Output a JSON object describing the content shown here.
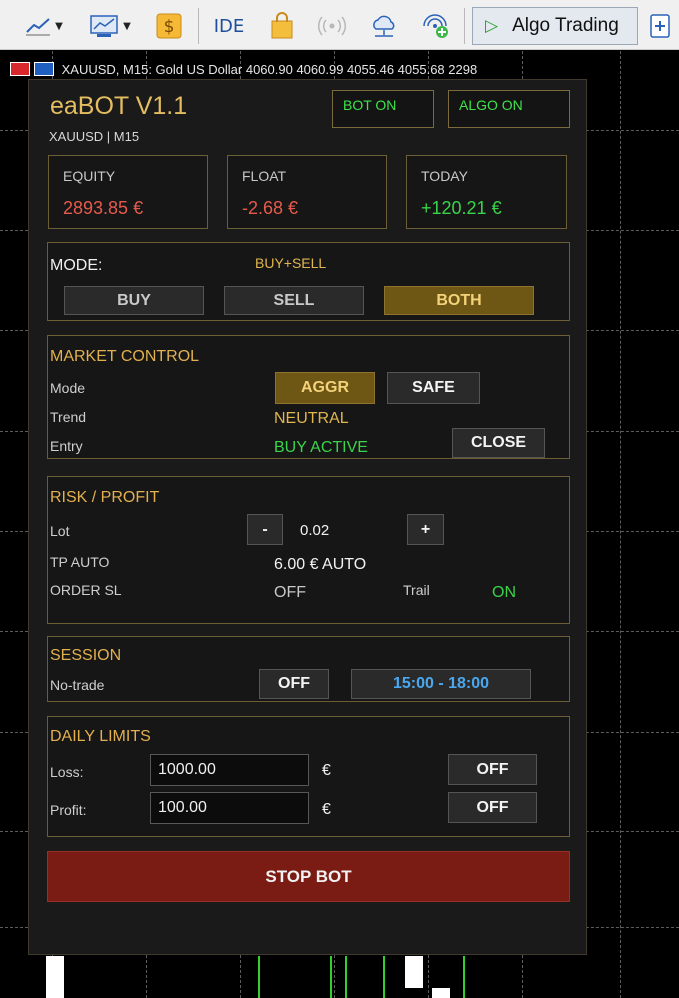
{
  "toolbar": {
    "ide_label": "IDE",
    "algo_label": "Algo Trading"
  },
  "chart": {
    "title": "XAUUSD, M15:  Gold US Dollar  4060.90 4060.99 4055.46 4055.68  2298"
  },
  "bot": {
    "title": "eaBOT V1.1",
    "subtitle": "XAUUSD | M15",
    "bot_on_label": "BOT ON",
    "algo_on_label": "ALGO ON",
    "cards": [
      {
        "label": "EQUITY",
        "value": "2893.85 €",
        "color": "#e65a4c"
      },
      {
        "label": "FLOAT",
        "value": "-2.68 €",
        "color": "#e65a4c"
      },
      {
        "label": "TODAY",
        "value": "+120.21 €",
        "color": "#39d44a"
      }
    ],
    "mode": {
      "label": "MODE:",
      "current": "BUY+SELL",
      "buttons": {
        "buy": "BUY",
        "sell": "SELL",
        "both": "BOTH"
      }
    },
    "market": {
      "title": "MARKET CONTROL",
      "mode_label": "Mode",
      "trend_label": "Trend",
      "entry_label": "Entry",
      "aggr": "AGGR",
      "safe": "SAFE",
      "trend_value": "NEUTRAL",
      "entry_value": "BUY ACTIVE",
      "close": "CLOSE"
    },
    "risk": {
      "title": "RISK / PROFIT",
      "lot_label": "Lot",
      "minus": "-",
      "lot_value": "0.02",
      "plus": "+",
      "tp_label": "TP AUTO",
      "tp_value": "6.00 € AUTO",
      "sl_label": "ORDER SL",
      "sl_value": "OFF",
      "trail_label": "Trail",
      "trail_value": "ON"
    },
    "session": {
      "title": "SESSION",
      "notrade_label": "No-trade",
      "off": "OFF",
      "time": "15:00 - 18:00"
    },
    "limits": {
      "title": "DAILY LIMITS",
      "loss_label": "Loss:",
      "loss_value": "1000.00",
      "profit_label": "Profit:",
      "profit_value": "100.00",
      "currency": "€",
      "loss_toggle": "OFF",
      "profit_toggle": "OFF"
    },
    "stop": "STOP BOT"
  }
}
